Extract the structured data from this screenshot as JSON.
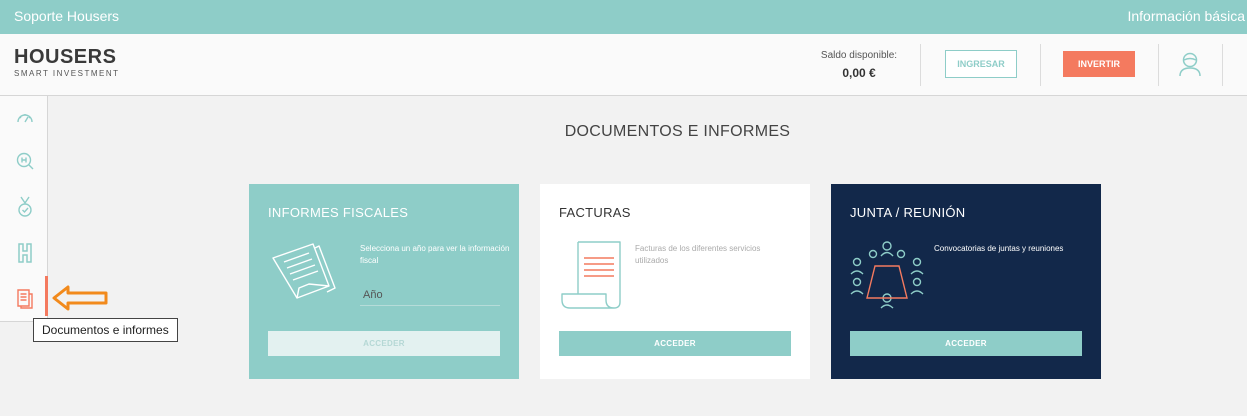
{
  "topbar": {
    "support": "Soporte Housers",
    "info": "Información básica"
  },
  "header": {
    "logo_word": "HOUSERS",
    "logo_sub": "SMART INVESTMENT",
    "balance_label": "Saldo disponible:",
    "balance_value": "0,00 €",
    "ingresar": "INGRESAR",
    "invertir": "INVERTIR",
    "user_icon": "user-avatar-icon"
  },
  "sidebar": {
    "items": [
      {
        "icon": "dashboard-gauge-icon"
      },
      {
        "icon": "search-property-icon"
      },
      {
        "icon": "medal-icon"
      },
      {
        "icon": "housers-h-icon"
      },
      {
        "icon": "documents-icon",
        "active": true
      }
    ],
    "tooltip": "Documentos e informes",
    "accent": "#f47a5f"
  },
  "page": {
    "title": "DOCUMENTOS E INFORMES"
  },
  "cards": {
    "fiscal": {
      "title": "INFORMES FISCALES",
      "desc": "Selecciona un año para ver la información fiscal",
      "year_placeholder": "Año",
      "button": "ACCEDER",
      "icon": "document-fold-icon"
    },
    "facturas": {
      "title": "FACTURAS",
      "desc": "Facturas de los diferentes servicios utilizados",
      "button": "ACCEDER",
      "icon": "invoice-scroll-icon"
    },
    "junta": {
      "title": "JUNTA / REUNIÓN",
      "desc": "Convocatorias de juntas y reuniones",
      "button": "ACCEDER",
      "icon": "meeting-table-icon"
    }
  },
  "colors": {
    "teal": "#8ecdc8",
    "coral": "#f47a5f",
    "navy": "#12284a"
  }
}
